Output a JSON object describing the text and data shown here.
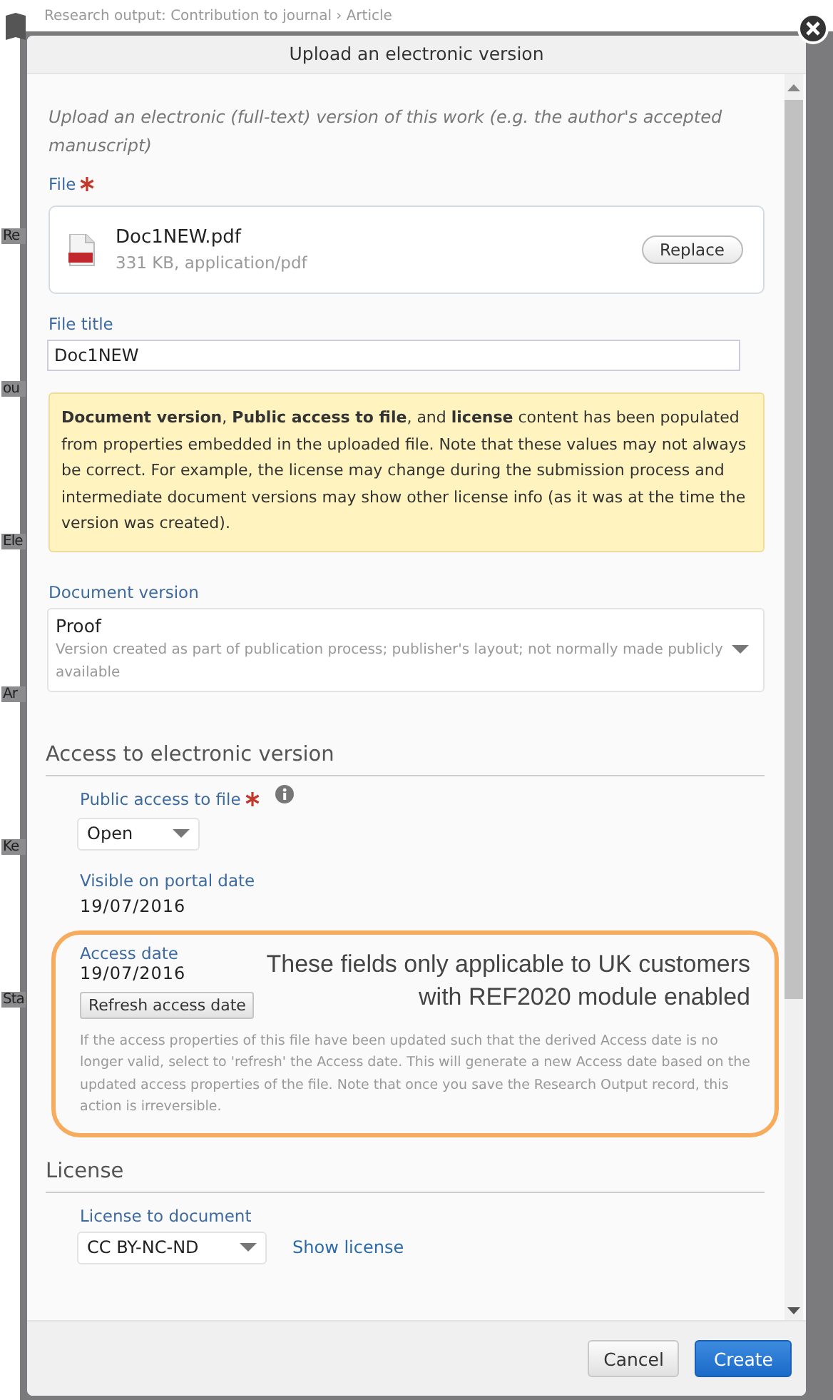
{
  "background": {
    "title": "Research output: Contribution to journal › Article",
    "edge_labels": [
      "Re",
      "ou",
      "Ele",
      "Ar",
      "Ke",
      "Sta"
    ]
  },
  "dialog": {
    "title": "Upload an electronic version",
    "intro": "Upload an electronic (full-text) version of this work (e.g. the author's accepted manuscript)",
    "file": {
      "label": "File",
      "required": true,
      "name": "Doc1NEW.pdf",
      "details": "331 KB, application/pdf",
      "replace_button": "Replace"
    },
    "file_title": {
      "label": "File title",
      "value": "Doc1NEW"
    },
    "notice": "**Document version**, **Public access to file**, and **license** content has been populated from properties embedded in the uploaded file. Note that these values may not always be correct. For example, the license may change during the submission process and intermediate document versions may show other license info (as it was at the time the version was created).",
    "document_version": {
      "label": "Document version",
      "value": "Proof",
      "description": "Version created as part of publication process; publisher's layout; not normally made publicly available"
    },
    "access_section": {
      "heading": "Access to electronic version",
      "public_access": {
        "label": "Public access to file",
        "required": true,
        "value": "Open"
      },
      "visible_on_portal": {
        "label": "Visible on portal date",
        "value": "19/07/2016"
      },
      "access_date": {
        "label": "Access date",
        "value": "19/07/2016",
        "refresh_button": "Refresh access date",
        "help": "If the access properties of this file have been updated such that the derived Access date is no longer valid, select to 'refresh' the Access date. This will generate a new Access date based on the updated access properties of the file. Note that once you save the Research Output record, this action is irreversible."
      },
      "annotation": "These fields only applicable to UK customers with REF2020 module enabled"
    },
    "license_section": {
      "heading": "License",
      "license": {
        "label": "License to document",
        "value": "CC BY-NC-ND",
        "link": "Show license"
      }
    },
    "buttons": [
      {
        "label": "Cancel",
        "kind": "secondary"
      },
      {
        "label": "Create",
        "kind": "primary"
      }
    ]
  }
}
